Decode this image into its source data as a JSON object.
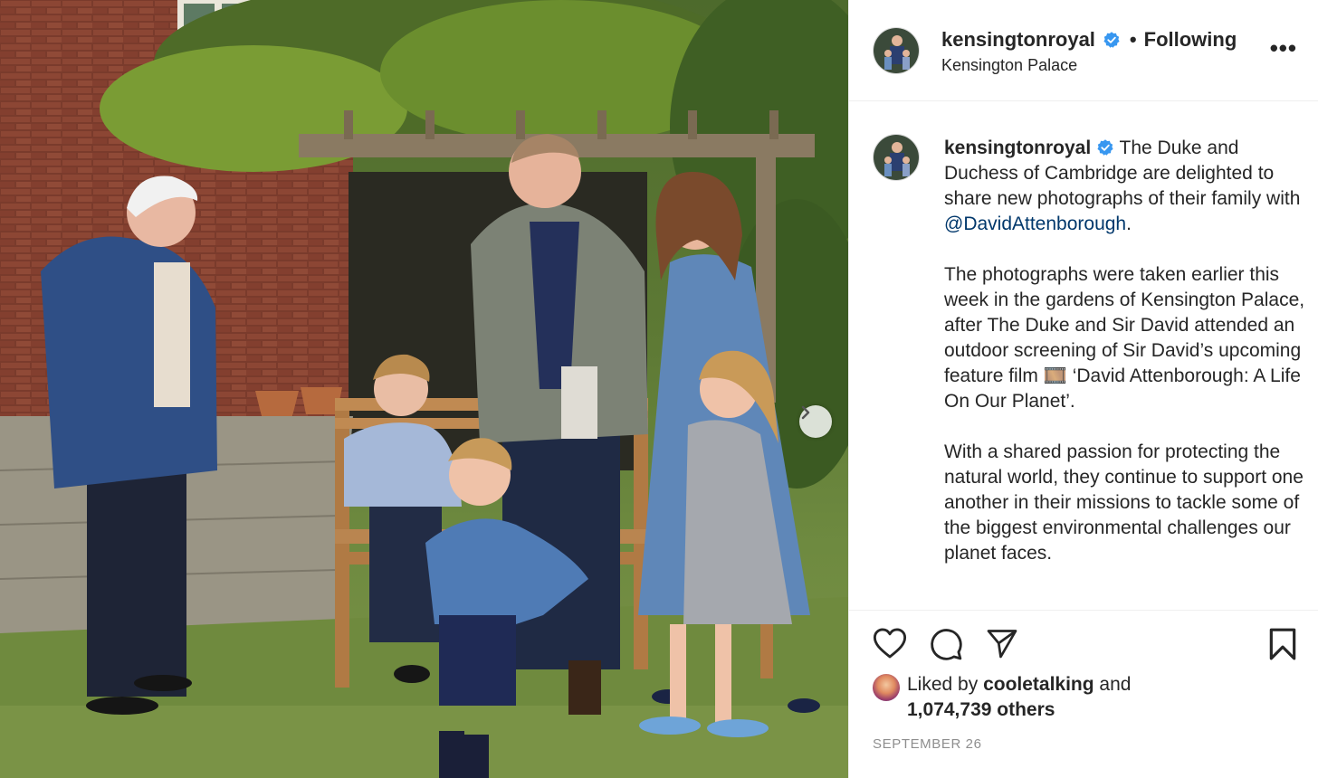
{
  "post": {
    "username": "kensingtonroyal",
    "follow_separator": "•",
    "follow_status": "Following",
    "location": "Kensington Palace",
    "more_label": "•••"
  },
  "caption": {
    "username": "kensingtonroyal",
    "line1": "The Duke and Duchess of Cambridge are delighted to share new photographs of their family with ",
    "mention": "@DavidAttenborough",
    "line1_end": ".",
    "para2": "The photographs were taken earlier this week in the gardens of Kensington Palace, after The Duke and Sir David attended an outdoor screening of Sir David’s upcoming feature film 🎞️ ‘David Attenborough: A Life On Our Planet’.",
    "para3": "With a shared passion for protecting the natural world, they continue to support one another in their missions to tackle some of the biggest environmental challenges our planet faces."
  },
  "likes": {
    "prefix": "Liked by ",
    "user": "cooletalking",
    "and": " and",
    "others": "1,074,739 others"
  },
  "date": "SEPTEMBER 26",
  "icons": {
    "like": "heart-icon",
    "comment": "comment-icon",
    "share": "paper-plane-icon",
    "save": "bookmark-icon",
    "verified": "verified-badge-icon",
    "next": "chevron-right-icon"
  },
  "colors": {
    "verified": "#3897f0",
    "mention": "#00376b",
    "muted": "#8e8e8e",
    "text": "#262626"
  }
}
